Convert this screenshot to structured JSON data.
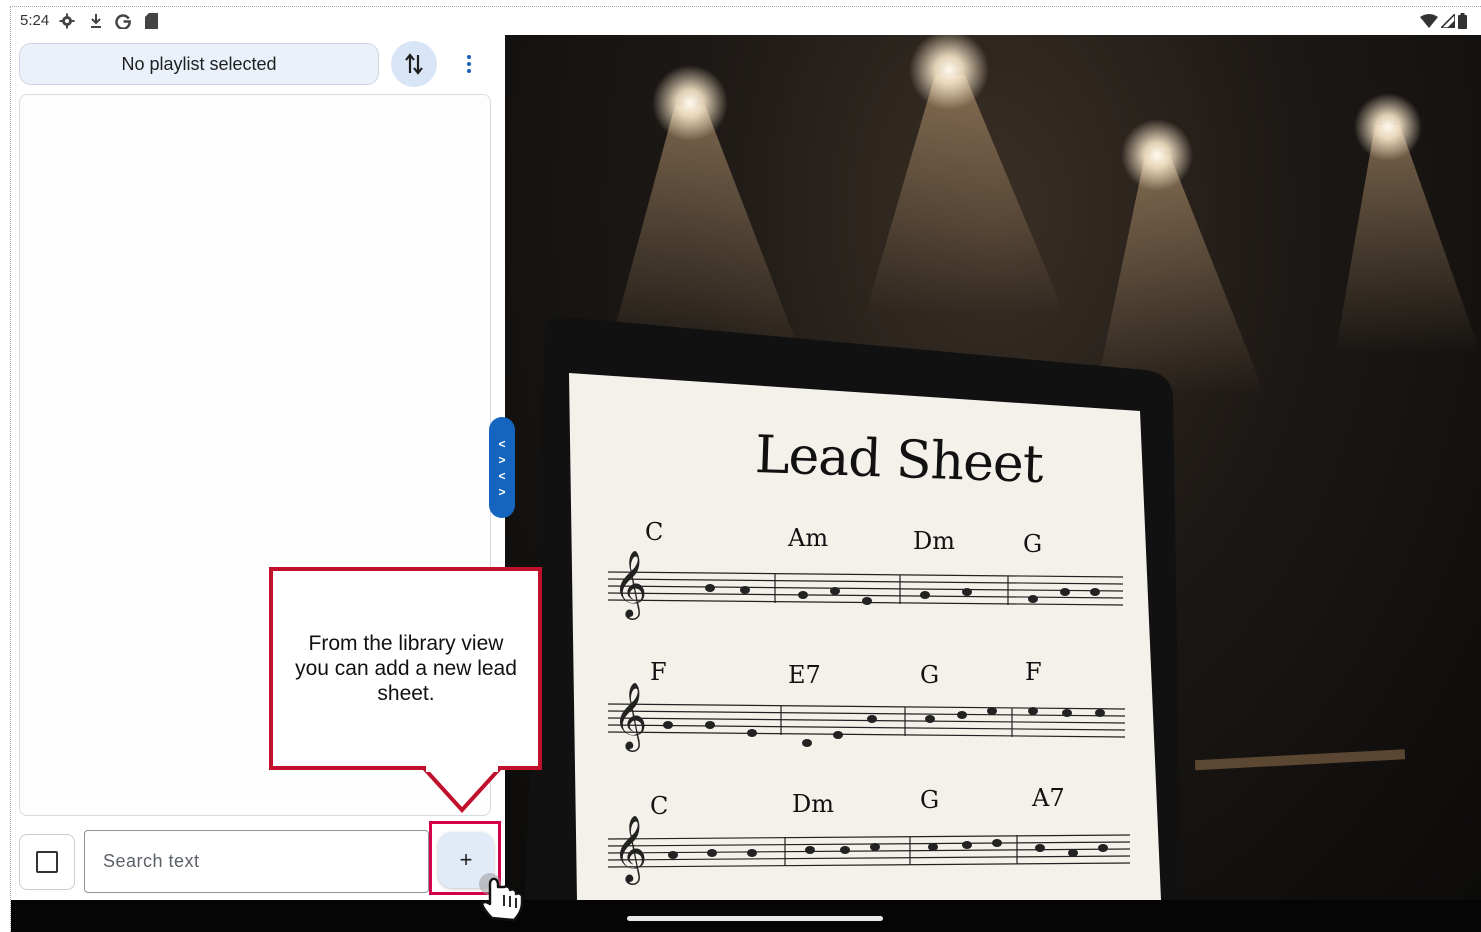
{
  "status_bar": {
    "time": "5:24",
    "left_icons": [
      "gear-icon",
      "download-icon",
      "google-icon",
      "sd-card-icon"
    ],
    "right_icons": [
      "wifi-icon",
      "signal-icon",
      "battery-icon"
    ]
  },
  "library": {
    "playlist_label": "No playlist selected",
    "sort_icon": "swap-vert-icon",
    "menu_icon": "more-vert-icon",
    "search_placeholder": "Search text",
    "add_label": "+"
  },
  "handle": {
    "chevrons": [
      "<",
      ">",
      "<",
      ">"
    ]
  },
  "media": {
    "sheet_title": "Lead Sheet",
    "chords_row1": [
      "C",
      "Am",
      "Dm",
      "G"
    ],
    "chords_row2": [
      "F",
      "E7",
      "G",
      "F"
    ],
    "chords_row3": [
      "C",
      "Dm",
      "G",
      "A7"
    ]
  },
  "callout": {
    "text": "From the library view you can add a new lead sheet."
  },
  "colors": {
    "accent": "#1565c0",
    "highlight": "#d6004a",
    "callout_border": "#c0102c",
    "pill_bg": "#eaf1fb"
  }
}
